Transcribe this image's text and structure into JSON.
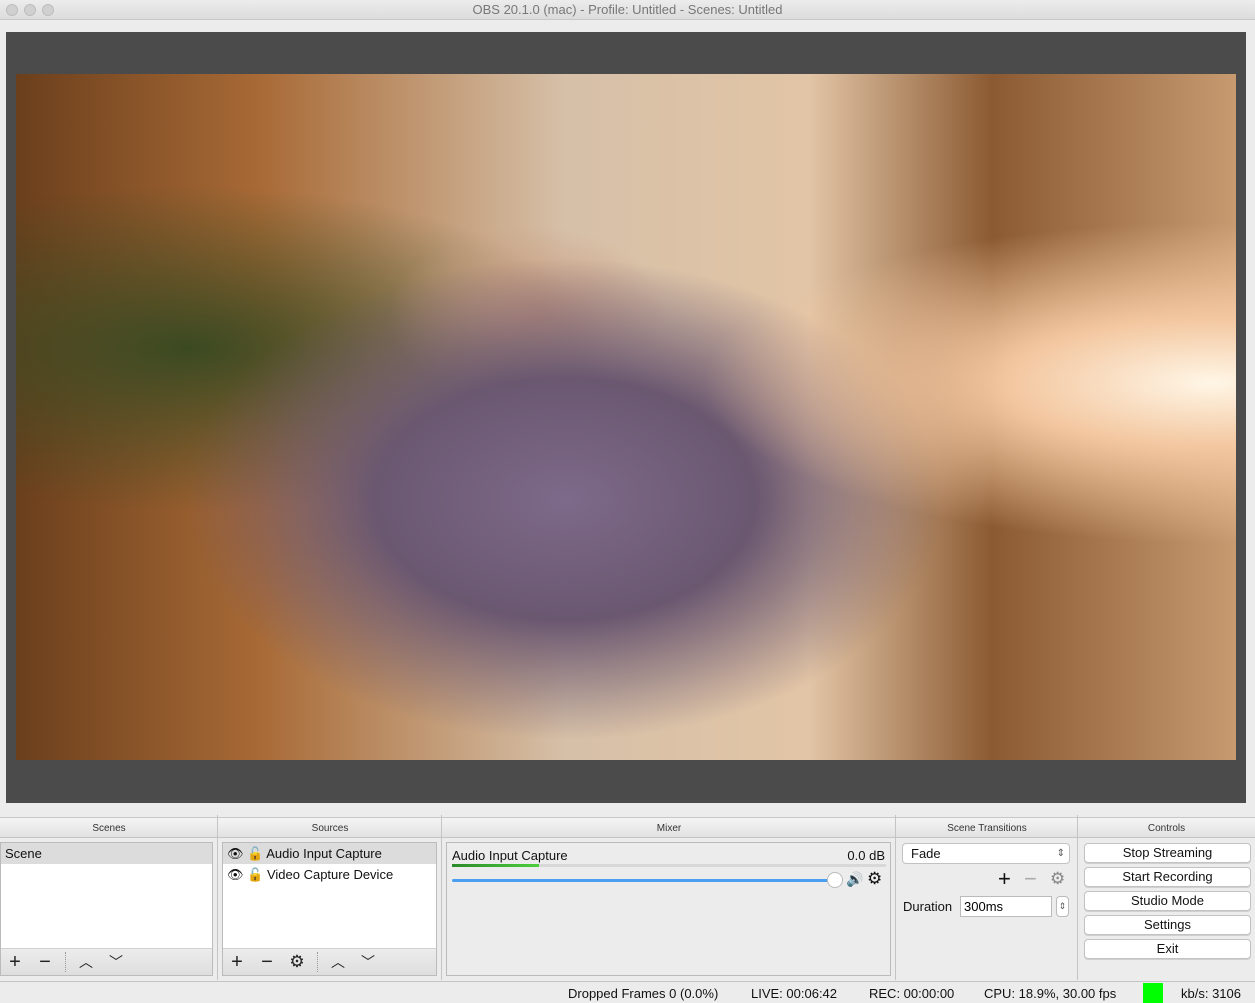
{
  "window": {
    "title": "OBS 20.1.0 (mac) - Profile: Untitled - Scenes: Untitled"
  },
  "panels": {
    "scenes": "Scenes",
    "sources": "Sources",
    "mixer": "Mixer",
    "transitions": "Scene Transitions",
    "controls": "Controls"
  },
  "scenes": {
    "items": [
      {
        "label": "Scene",
        "selected": true
      }
    ]
  },
  "sources": {
    "items": [
      {
        "label": "Audio Input Capture",
        "visible": true,
        "locked": false,
        "selected": true
      },
      {
        "label": "Video Capture Device",
        "visible": true,
        "locked": false
      }
    ]
  },
  "mixer": {
    "channels": [
      {
        "name": "Audio Input Capture",
        "db": "0.0 dB",
        "volume_percent": 100,
        "meter_percent": 20,
        "slider_color": "#4a9ff0",
        "meter_color": "#2a9a2a"
      }
    ]
  },
  "transitions": {
    "selected": "Fade",
    "duration_label": "Duration",
    "duration_value": "300ms"
  },
  "controls": {
    "buttons": [
      "Stop Streaming",
      "Start Recording",
      "Studio Mode",
      "Settings",
      "Exit"
    ]
  },
  "status": {
    "dropped": "Dropped Frames 0 (0.0%)",
    "live": "LIVE: 00:06:42",
    "rec": "REC: 00:00:00",
    "cpu": "CPU: 18.9%, 30.00 fps",
    "kbps": "kb/s: 3106",
    "indicator_color": "#00ff00"
  }
}
